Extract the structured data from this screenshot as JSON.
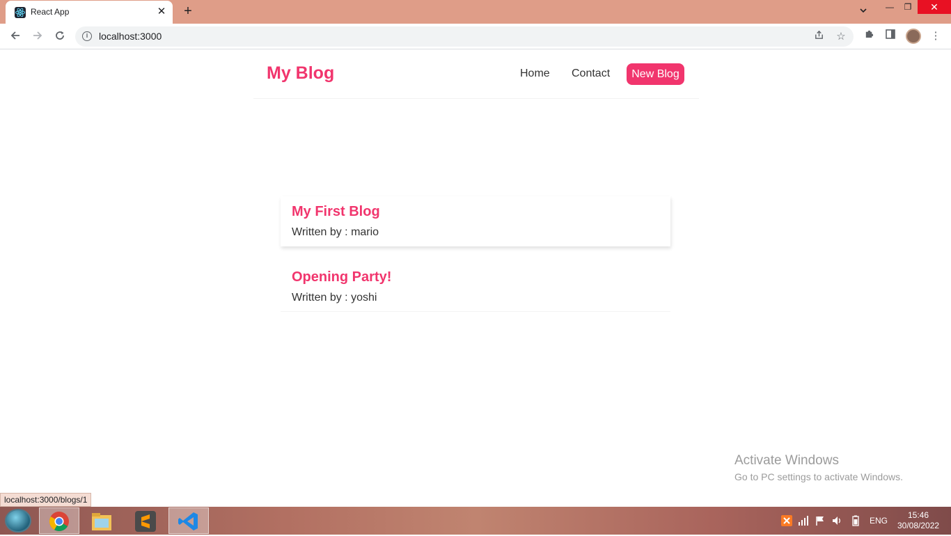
{
  "browser": {
    "tab_title": "React App",
    "tab_close": "✕",
    "new_tab": "+",
    "url": "localhost:3000",
    "status_url": "localhost:3000/blogs/1",
    "window_controls": {
      "minimize": "—",
      "restore": "❐",
      "close": "✕"
    }
  },
  "site": {
    "brand": "My Blog",
    "nav": {
      "home": "Home",
      "contact": "Contact",
      "new_blog": "New Blog"
    },
    "blogs": [
      {
        "title": "My First Blog",
        "author": "Written by : mario"
      },
      {
        "title": "Opening Party!",
        "author": "Written by : yoshi"
      }
    ]
  },
  "watermark": {
    "title": "Activate Windows",
    "subtitle": "Go to PC settings to activate Windows."
  },
  "taskbar": {
    "apps": [
      "chrome-icon",
      "file-explorer-icon",
      "sublime-text-icon",
      "vscode-icon"
    ],
    "language": "ENG",
    "time": "15:46",
    "date": "30/08/2022"
  },
  "colors": {
    "accent": "#f1356d",
    "titlebar": "#df9d88"
  }
}
